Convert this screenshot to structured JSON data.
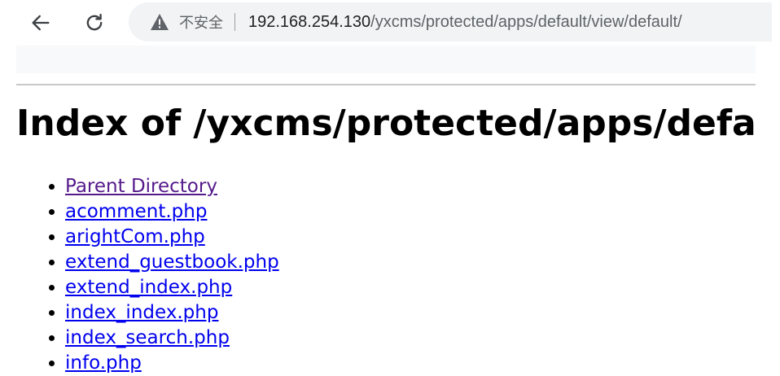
{
  "browser": {
    "security_label": "不安全",
    "url_host": "192.168.254.130",
    "url_path": "/yxcms/protected/apps/default/view/default/"
  },
  "page": {
    "heading": "Index of /yxcms/protected/apps/default/view/default",
    "entries": [
      {
        "label": "Parent Directory",
        "visited": true
      },
      {
        "label": "acomment.php",
        "visited": false
      },
      {
        "label": "arightCom.php",
        "visited": false
      },
      {
        "label": "extend_guestbook.php",
        "visited": false
      },
      {
        "label": "extend_index.php",
        "visited": false
      },
      {
        "label": "index_index.php",
        "visited": false
      },
      {
        "label": "index_search.php",
        "visited": false
      },
      {
        "label": "info.php",
        "visited": false
      }
    ]
  },
  "colors": {
    "link": "#0000ee",
    "visited_link": "#551a8b",
    "omnibox_bg": "#f1f3f4"
  },
  "icons": {
    "back": "arrow-left-icon",
    "reload": "reload-icon",
    "security": "warning-triangle-icon"
  }
}
